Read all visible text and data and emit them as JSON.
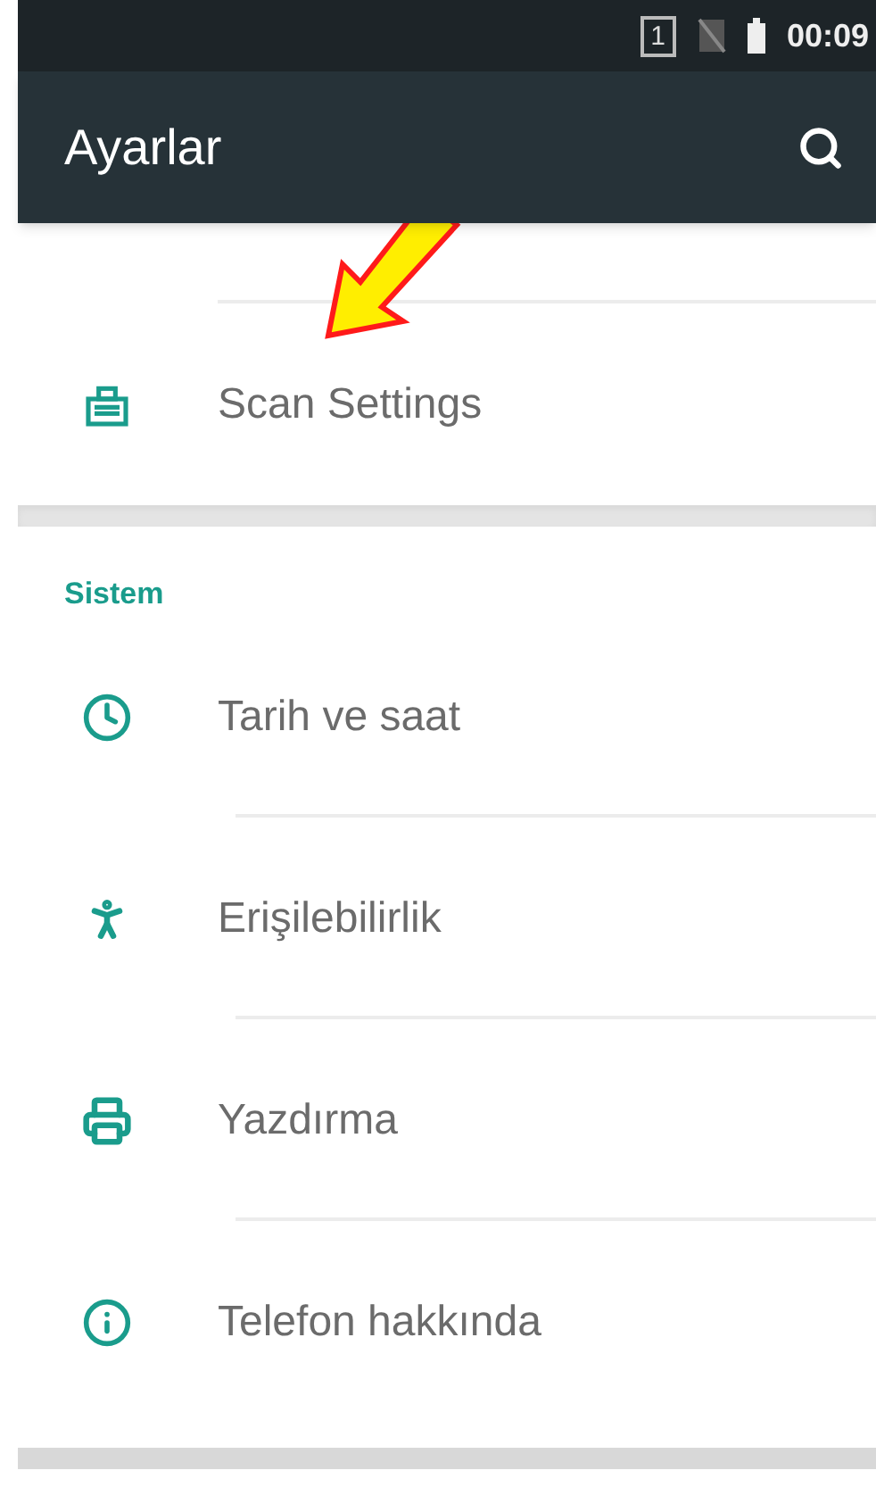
{
  "status_bar": {
    "sim_badge": "1",
    "time": "00:09"
  },
  "app_bar": {
    "title": "Ayarlar"
  },
  "top_section": {
    "items": [
      {
        "label": "Scan Settings",
        "kind": "scanner"
      }
    ]
  },
  "sections": [
    {
      "header": "Sistem",
      "items": [
        {
          "label": "Tarih ve saat",
          "kind": "clock"
        },
        {
          "label": "Erişilebilirlik",
          "kind": "accessibility"
        },
        {
          "label": "Yazdırma",
          "kind": "printer"
        },
        {
          "label": "Telefon hakkında",
          "kind": "info"
        }
      ]
    }
  ]
}
